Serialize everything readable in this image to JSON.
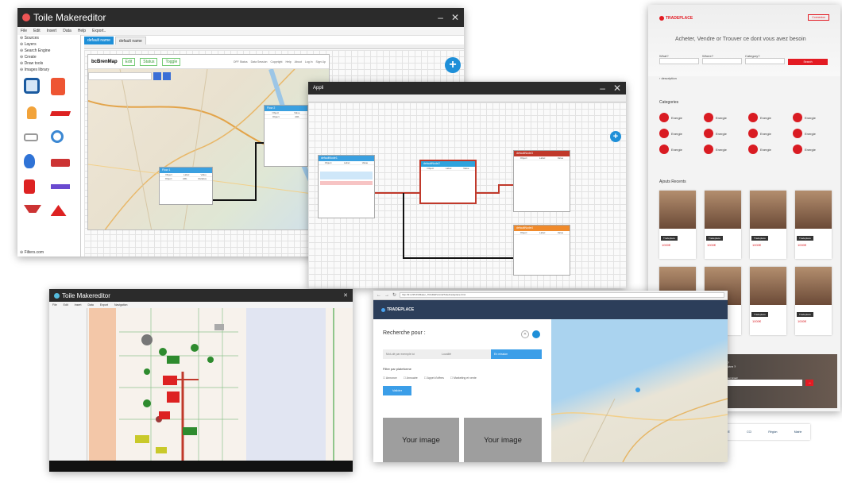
{
  "win1": {
    "app_name": "Toile Makereditor",
    "menu": [
      "File",
      "Edit",
      "Insert",
      "Data",
      "Help",
      "Export.."
    ],
    "sidebar_sections": [
      "Sources",
      "Layers",
      "Search Engine",
      "Create",
      "Draw tools",
      "Images library"
    ],
    "sidebar_footer": "Filters.com",
    "tabs": [
      "default name",
      "default name"
    ],
    "map_title": "bcBrenMap",
    "map_buttons": [
      "Edit",
      "Status",
      "Toggle"
    ],
    "top_links": [
      "OFF Status",
      "Data Session",
      "Copyright",
      "Help",
      "About",
      "Log In",
      "Sign Up"
    ],
    "node1_title": "Flow 1",
    "node2_title": "Flow 2",
    "node_fields": [
      "Object",
      "Label",
      "Value"
    ],
    "node_rows": [
      "Object",
      "ARL",
      "Relative"
    ]
  },
  "win2": {
    "app_name": "Appli",
    "nodes": [
      {
        "title": "defaultNode1",
        "color": "#3aa0e0"
      },
      {
        "title": "defaultNode2",
        "color": "#2ea3dd"
      },
      {
        "title": "defaultNode3",
        "color": "#c0392b"
      },
      {
        "title": "defaultNode4",
        "color": "#f08a2b"
      }
    ],
    "node_fields": [
      "Object",
      "Label",
      "Value"
    ]
  },
  "tradeplace": {
    "brand": "TRADEPLACE",
    "header_button": "Connexion",
    "hero": "Acheter, Vendre or Trouver ce dont vous avez besoin",
    "labels": [
      "What?",
      "Where?",
      "Category?"
    ],
    "search_button": "Search",
    "description_link": "description",
    "categories_title": "Categories",
    "category_item": "Energie",
    "recent_title": "Ajouts Recents",
    "card_label": "Crédit",
    "card_badge": "Tradeplace",
    "card_price": "1000€",
    "cta_text1": "Intéressé pour valoriser un déchet ?",
    "cta_text2": "Vous recherchez une matière première ?",
    "cta_labels": [
      "Category?",
      "Your Email"
    ],
    "cta_button": "→",
    "partner_logos": [
      "toile",
      "ADEME",
      "CCI",
      "Région",
      "Mairie"
    ]
  },
  "win3": {
    "app_name": "Toile Makereditor",
    "menu": [
      "File",
      "Edit",
      "Insert",
      "Data",
      "Export",
      "Navigation"
    ]
  },
  "tradeplace2": {
    "url": "http://91.235.69/Maker_TRADEPLACE/Toile/tradeplace.html",
    "brand": "TRADEPLACE",
    "search_title": "Recherche pour :",
    "inputs": [
      "Mot-clé par exemple ici",
      "Localité",
      "En mission"
    ],
    "filter_title": "Filtre par plateforme",
    "filters": [
      "Annonce",
      "Annuaire",
      "Appel d'offres",
      "Marketing et vente"
    ],
    "submit": "Valider",
    "images": [
      "Your image",
      "Your image"
    ]
  },
  "colors": {
    "dark_title": "#2b2b2b",
    "accent_blue": "#1e8fd8",
    "brand_red": "#e31b23",
    "node_orange": "#f08a2b"
  }
}
